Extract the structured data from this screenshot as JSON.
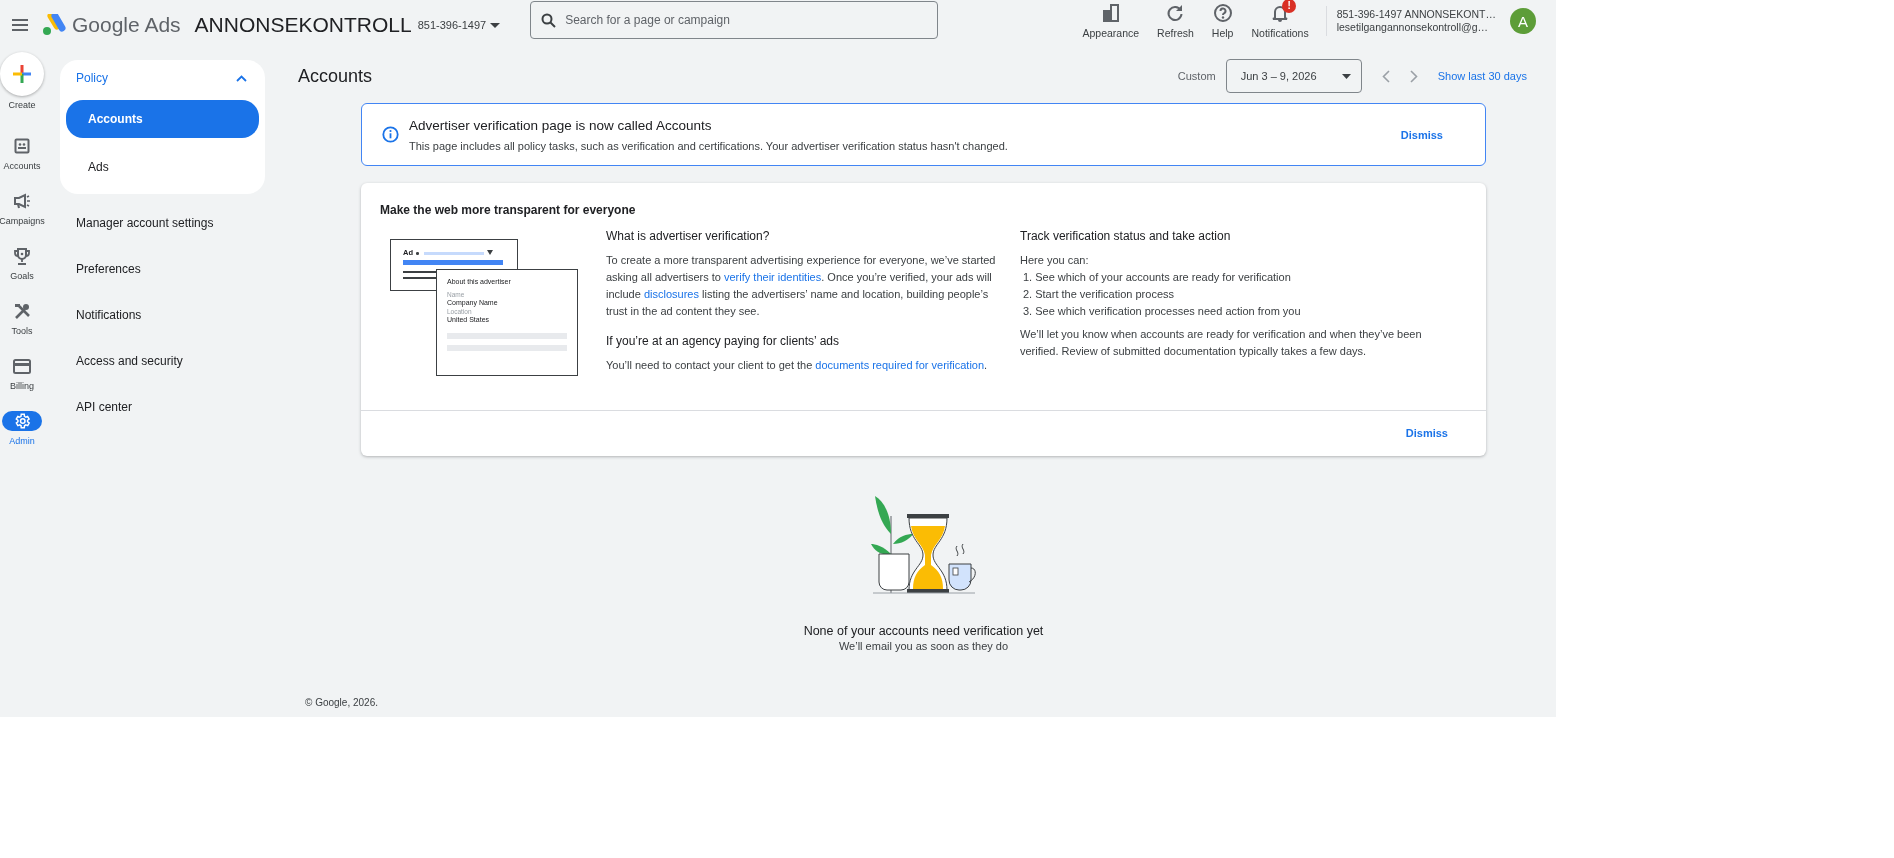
{
  "header": {
    "app_name": "Google Ads",
    "account_name": "ANNONSEKONTROLL",
    "account_id": "851-396-1497",
    "search": {
      "placeholder": "Search for a page or campaign"
    },
    "actions": [
      {
        "label": "Appearance",
        "kind": "appearance"
      },
      {
        "label": "Refresh",
        "kind": "refresh"
      },
      {
        "label": "Help",
        "kind": "help"
      },
      {
        "label": "Notifications",
        "kind": "notifications",
        "badge": "!"
      }
    ],
    "user": {
      "account": "851-396-1497 ANNONSEKONT…",
      "email": "lesetilgangannonsekontroll@g…",
      "avatar": "A"
    }
  },
  "rail": [
    {
      "label": "Create",
      "kind": "create",
      "selected": false
    },
    {
      "label": "Accounts",
      "kind": "accounts",
      "selected": false
    },
    {
      "label": "Campaigns",
      "kind": "campaigns",
      "selected": false
    },
    {
      "label": "Goals",
      "kind": "goals",
      "selected": false
    },
    {
      "label": "Tools",
      "kind": "tools",
      "selected": false
    },
    {
      "label": "Billing",
      "kind": "billing",
      "selected": false
    },
    {
      "label": "Admin",
      "kind": "admin",
      "selected": true
    }
  ],
  "subnav": {
    "group": {
      "label": "Policy",
      "expanded": true,
      "items": [
        {
          "label": "Accounts",
          "selected": true
        },
        {
          "label": "Ads",
          "selected": false
        }
      ]
    },
    "items": [
      "Manager account settings",
      "Preferences",
      "Notifications",
      "Access and security",
      "API center"
    ]
  },
  "page": {
    "title": "Accounts",
    "date_range": {
      "label": "Custom",
      "value": "Jun 3 – 9, 2026",
      "show_last": "Show last 30 days"
    }
  },
  "banner": {
    "title": "Advertiser verification page is now called Accounts",
    "text": "This page includes all policy tasks, such as verification and certifications. Your advertiser verification status hasn't changed.",
    "dismiss": "Dismiss"
  },
  "info_card": {
    "heading": "Make the web more transparent for everyone",
    "illustration": {
      "ad_label": "Ad",
      "panel_title": "About this advertiser",
      "name_label": "Name",
      "name": "Company Name",
      "location_label": "Location",
      "location": "United States"
    },
    "left": [
      {
        "heading": "What is advertiser verification?",
        "parts": [
          {
            "text": "To create a more transparent advertising experience for everyone, we’ve started asking all advertisers to "
          },
          {
            "link": "verify their identities"
          },
          {
            "text": ". Once you’re verified, your ads will include "
          },
          {
            "link": "disclosures"
          },
          {
            "text": " listing the advertisers’ name and location, building people’s trust in the ad content they see."
          }
        ]
      },
      {
        "heading": "If you’re at an agency paying for clients’ ads",
        "parts": [
          {
            "text": "You’ll need to contact your client to get the "
          },
          {
            "link": "documents required for verification"
          },
          {
            "text": "."
          }
        ]
      }
    ],
    "right": {
      "heading": "Track verification status and take action",
      "intro": "Here you can:",
      "steps": [
        "1. See which of your accounts are ready for verification",
        "2. Start the verification process",
        "3. See which verification processes need action from you"
      ],
      "note": "We’ll let you know when accounts are ready for verification and when they’ve been verified. Review of submitted documentation typically takes a few days."
    },
    "dismiss": "Dismiss"
  },
  "empty_state": {
    "title": "None of your accounts need verification yet",
    "subtitle": "We’ll email you as soon as they do"
  },
  "footer": "© Google, 2026."
}
